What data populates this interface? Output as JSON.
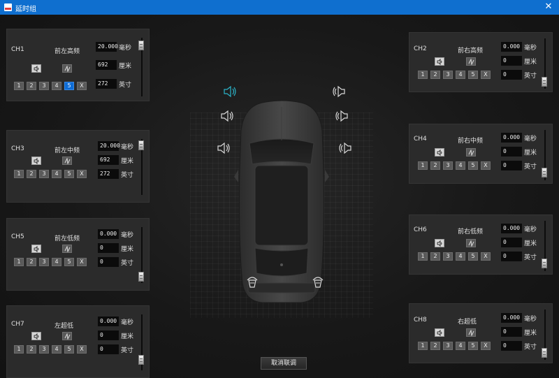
{
  "window": {
    "title": "延时组",
    "close_label": "✕"
  },
  "buttons": [
    "1",
    "2",
    "3",
    "4",
    "5",
    "X"
  ],
  "units": {
    "ms": "毫秒",
    "cm": "厘米",
    "inch": "英寸"
  },
  "channels": {
    "ch1": {
      "id": "CH1",
      "name": "前左高频",
      "ms": "20.000",
      "cm": "692",
      "inch": "272",
      "active": "5",
      "level": 0.85
    },
    "ch2": {
      "id": "CH2",
      "name": "前右高频",
      "ms": "0.000",
      "cm": "0",
      "inch": "0",
      "active": "",
      "level": 0.1
    },
    "ch3": {
      "id": "CH3",
      "name": "前左中频",
      "ms": "20.000",
      "cm": "692",
      "inch": "272",
      "active": "",
      "level": 0.85
    },
    "ch4": {
      "id": "CH4",
      "name": "前右中频",
      "ms": "0.000",
      "cm": "0",
      "inch": "0",
      "active": "",
      "level": 0.1
    },
    "ch5": {
      "id": "CH5",
      "name": "前左低频",
      "ms": "0.000",
      "cm": "0",
      "inch": "0",
      "active": "",
      "level": 0.1
    },
    "ch6": {
      "id": "CH6",
      "name": "前右低频",
      "ms": "0.000",
      "cm": "0",
      "inch": "0",
      "active": "",
      "level": 0.1
    },
    "ch7": {
      "id": "CH7",
      "name": "左超低",
      "ms": "0.000",
      "cm": "0",
      "inch": "0",
      "active": "",
      "level": 0.1
    },
    "ch8": {
      "id": "CH8",
      "name": "右超低",
      "ms": "0.000",
      "cm": "0",
      "inch": "0",
      "active": "",
      "level": 0.1
    }
  },
  "colors": {
    "accent": "#0d6cd6",
    "titlebar": "#0f6fcf",
    "speaker_active": "#2bb3c8",
    "speaker_idle": "#d9d9d9"
  },
  "speakers": [
    {
      "name": "front-left-tweeter-speaker-icon",
      "state": "active"
    },
    {
      "name": "front-right-tweeter-speaker-icon",
      "state": "idle"
    },
    {
      "name": "front-left-mid-speaker-icon",
      "state": "idle"
    },
    {
      "name": "front-right-mid-speaker-icon",
      "state": "idle"
    },
    {
      "name": "front-left-woofer-speaker-icon",
      "state": "idle"
    },
    {
      "name": "front-right-woofer-speaker-icon",
      "state": "idle"
    },
    {
      "name": "left-subwoofer-icon",
      "state": "idle"
    },
    {
      "name": "right-subwoofer-icon",
      "state": "idle"
    }
  ],
  "cancel_link_label": "取消联调"
}
